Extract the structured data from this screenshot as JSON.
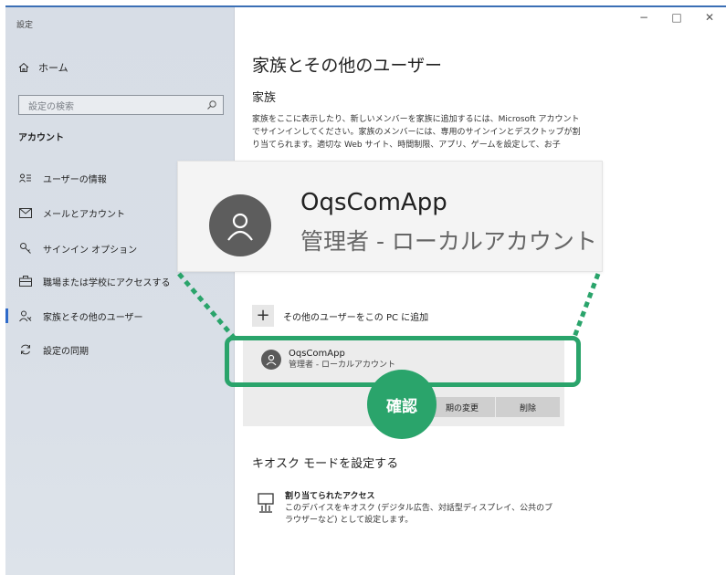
{
  "window": {
    "title": "設定",
    "controls": {
      "minimize": "−",
      "maximize": "□",
      "close": "✕"
    }
  },
  "sidebar": {
    "home": "ホーム",
    "search_placeholder": "設定の検索",
    "section": "アカウント",
    "items": [
      {
        "label": "ユーザーの情報",
        "icon": "user-info-icon"
      },
      {
        "label": "メールとアカウント",
        "icon": "mail-icon"
      },
      {
        "label": "サインイン オプション",
        "icon": "key-icon"
      },
      {
        "label": "職場または学校にアクセスする",
        "icon": "briefcase-icon"
      },
      {
        "label": "家族とその他のユーザー",
        "icon": "people-icon",
        "active": true
      },
      {
        "label": "設定の同期",
        "icon": "sync-icon"
      }
    ]
  },
  "main": {
    "title": "家族とその他のユーザー",
    "family": {
      "heading": "家族",
      "description": "家族をここに表示したり、新しいメンバーを家族に追加するには、Microsoft アカウントでサインインしてください。家族のメンバーには、専用のサインインとデスクトップが割り当てられます。適切な Web サイト、時間制限、アプリ、ゲームを設定して、お子"
    },
    "add_user": "その他のユーザーをこの PC に追加",
    "user": {
      "name": "OqsComApp",
      "role": "管理者 - ローカルアカウント"
    },
    "buttons": {
      "change_type": "期の変更",
      "remove": "削除"
    },
    "kiosk": {
      "heading": "キオスク モードを設定する",
      "item_title": "割り当てられたアクセス",
      "item_desc": "このデバイスをキオスク (デジタル広告、対話型ディスプレイ、公共のブラウザーなど) として設定します。"
    }
  },
  "callout": {
    "user_name": "OqsComApp",
    "user_role": "管理者 - ローカルアカウント",
    "badge": "確認"
  },
  "colors": {
    "accent": "#2aa46b",
    "nav_active": "#2e6ac9"
  }
}
